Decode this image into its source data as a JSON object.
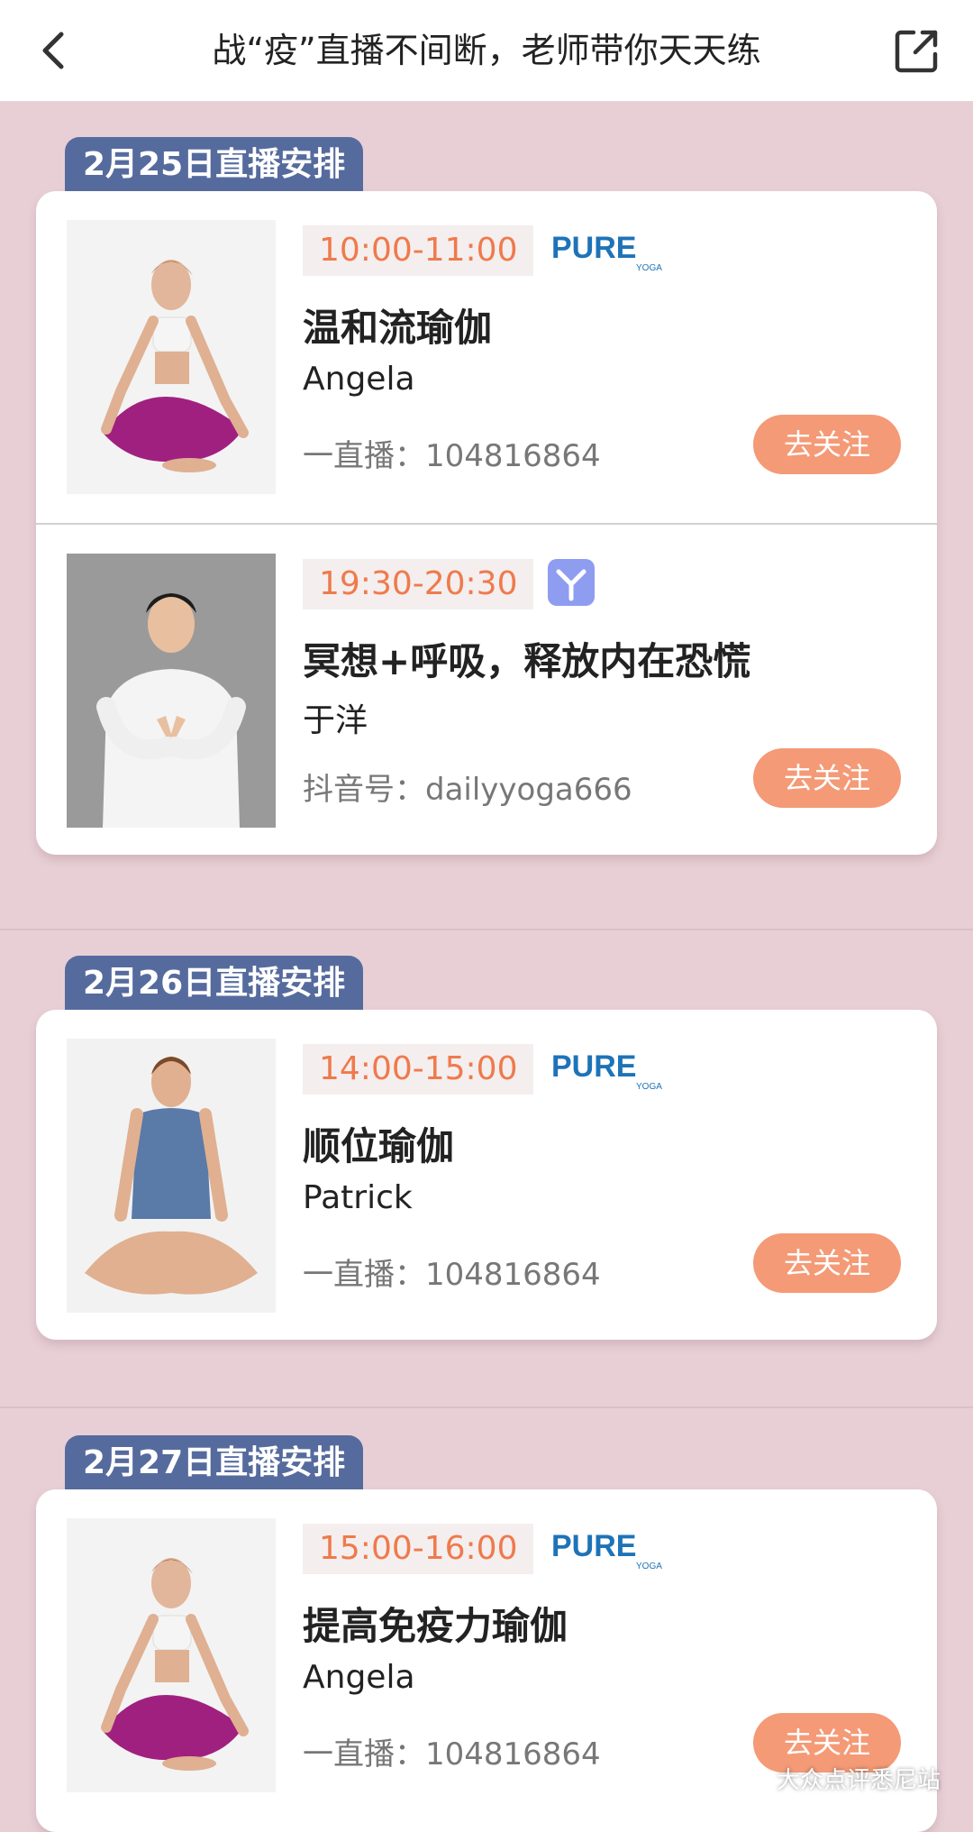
{
  "header": {
    "title": "战“疫”直播不间断，老师带你天天练",
    "back_icon": "chevron-left-icon",
    "share_icon": "share-external-icon"
  },
  "colors": {
    "background": "#e8cfd6",
    "date_tab": "#566b9d",
    "time_text": "#ef7a4c",
    "follow_button": "#f49a76",
    "pure_brand": "#1e73b8",
    "app_logo": "#8e9df0"
  },
  "sections": [
    {
      "date_label": "2月25日直播安排",
      "items": [
        {
          "time": "10:00-11:00",
          "logo": "pure-yoga-logo",
          "course": "温和流瑜伽",
          "teacher": "Angela",
          "account": "一直播：104816864",
          "button": "去关注",
          "photo": "woman-yoga-pose-photo"
        },
        {
          "time": "19:30-20:30",
          "logo": "daily-yoga-app-icon",
          "course": "冥想+呼吸，释放内在恐慌",
          "teacher": "于洋",
          "account": "抖音号：dailyyoga666",
          "button": "去关注",
          "photo": "man-meditation-photo"
        }
      ]
    },
    {
      "date_label": "2月26日直播安排",
      "items": [
        {
          "time": "14:00-15:00",
          "logo": "pure-yoga-logo",
          "course": "顺位瑜伽",
          "teacher": "Patrick",
          "account": "一直播：104816864",
          "button": "去关注",
          "photo": "man-seated-yoga-photo"
        }
      ]
    },
    {
      "date_label": "2月27日直播安排",
      "items": [
        {
          "time": "15:00-16:00",
          "logo": "pure-yoga-logo",
          "course": "提高免疫力瑜伽",
          "teacher": "Angela",
          "account": "一直播：104816864",
          "button": "去关注",
          "photo": "woman-yoga-pose-photo"
        }
      ]
    }
  ],
  "brand": {
    "pure_text": "PURE",
    "pure_sub": "YOGA"
  },
  "watermark": "大众点评悉尼站"
}
